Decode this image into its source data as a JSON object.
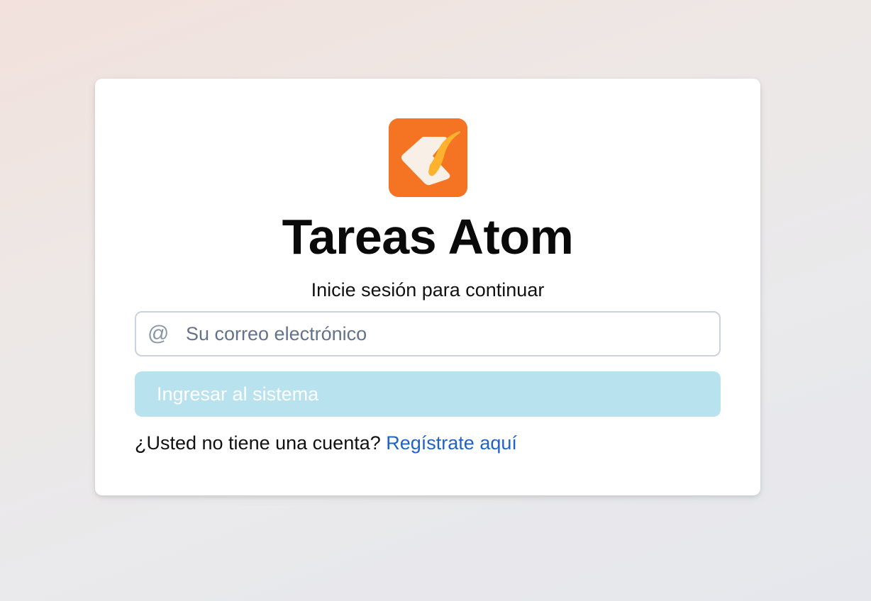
{
  "app": {
    "logo_icon": "task-check-icon",
    "title": "Tareas Atom",
    "subtitle": "Inicie sesión para continuar"
  },
  "login": {
    "email_icon": "at-sign-icon",
    "email_placeholder": "Su correo electrónico",
    "email_value": "",
    "submit_label": "Ingresar al sistema",
    "no_account_text": "¿Usted no tiene una cuenta?",
    "register_link": "Regístrate aquí"
  },
  "colors": {
    "brand_orange": "#f47423",
    "button_disabled": "#b8e2ee",
    "link": "#1f63c7"
  }
}
